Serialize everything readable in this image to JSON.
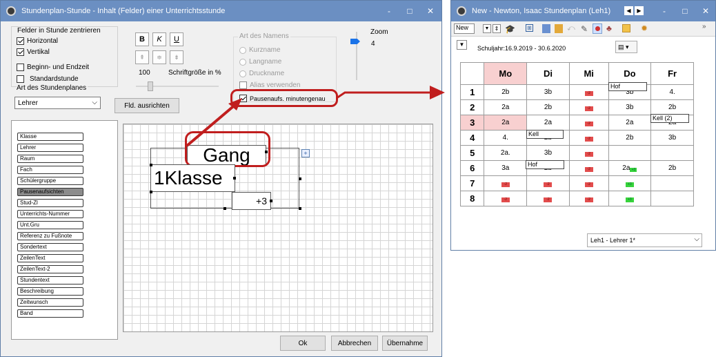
{
  "left_window": {
    "title": "Stundenplan-Stunde - Inhalt (Felder) einer Unterrichtsstunde",
    "min": "-",
    "max": "□",
    "close": "✕"
  },
  "options": {
    "center_label": "Felder in Stunde zentrieren",
    "horizontal": "Horizontal",
    "vertical": "Vertikal",
    "begin_end": "Beginn- und Endzeit",
    "standard": "Standardstunde",
    "plan_type_label": "Art des Stundenplanes",
    "plan_type_value": "Lehrer"
  },
  "format": {
    "bold": "B",
    "italic": "K",
    "underline": "U",
    "size_value": "100",
    "size_label": "Schriftgröße in %",
    "align_button": "Fld. ausrichten"
  },
  "name_type": {
    "label": "Art des Namens",
    "kurzname": "Kurzname",
    "langname": "Langname",
    "druckname": "Druckname",
    "alias": "Alias verwenden",
    "pausen": "Pausenaufs. minutengenau"
  },
  "zoom": {
    "label": "Zoom",
    "value": "4"
  },
  "fields": [
    "Klasse",
    "Lehrer",
    "Raum",
    "Fach",
    "Schülergruppe",
    "Pausenaufsichten",
    "Stud-Zl",
    "Unterrichts-Nummer",
    "Unt.Gru",
    "Referenz zu Fußnote",
    "Sondertext",
    "ZeilenText",
    "ZeilenText-2",
    "Stundentext",
    "Beschreibung",
    "Zeitwunsch",
    "Band"
  ],
  "canvas": {
    "gang": "Gang",
    "klasse": "1Klasse",
    "plus": "+3"
  },
  "buttons": {
    "ok": "Ok",
    "cancel": "Abbrechen",
    "apply": "Übernahme"
  },
  "right_window": {
    "title": "New - Newton, Isaac  Stundenplan  (Leh1)",
    "min": "-",
    "max": "□",
    "close": "✕",
    "nav_prev": "◀",
    "nav_next": "▶",
    "toolbar_select": "New",
    "chevron": "»",
    "school_year": "Schuljahr:16.9.2019 - 30.6.2020",
    "bottom_select": "Leh1 - Lehrer 1*"
  },
  "timetable": {
    "days": [
      "Mo",
      "Di",
      "Mi",
      "Do",
      "Fr"
    ],
    "periods": [
      "1",
      "2",
      "3",
      "4",
      "5",
      "6",
      "7",
      "8"
    ],
    "cells": [
      [
        "2b",
        "3b",
        "-2",
        "3b",
        "4."
      ],
      [
        "2a",
        "2b",
        "-2",
        "3b",
        "2b"
      ],
      [
        "2a",
        "2a",
        "-2",
        "2a",
        "2a"
      ],
      [
        "4.",
        "2b",
        "-2",
        "2b",
        "3b"
      ],
      [
        "2a.",
        "3b",
        "-2",
        "",
        ""
      ],
      [
        "3a",
        "2b",
        "-2",
        "2a",
        "2b"
      ],
      [
        "-2",
        "-2",
        "-2",
        "+3",
        ""
      ],
      [
        "-2",
        "-2",
        "-2",
        "+3",
        ""
      ]
    ],
    "labels": {
      "hof1": "Hof",
      "kell2": "Kell (2)",
      "kell": "Kell",
      "hof2": "Hof",
      "plus_small": "+3"
    }
  },
  "colors": {
    "accent_red": "#c01e1e",
    "title_blue": "#6b8fc2",
    "red_marker": "#e24c4c",
    "green_marker": "#37d33b",
    "pink": "#f8d0d0"
  }
}
